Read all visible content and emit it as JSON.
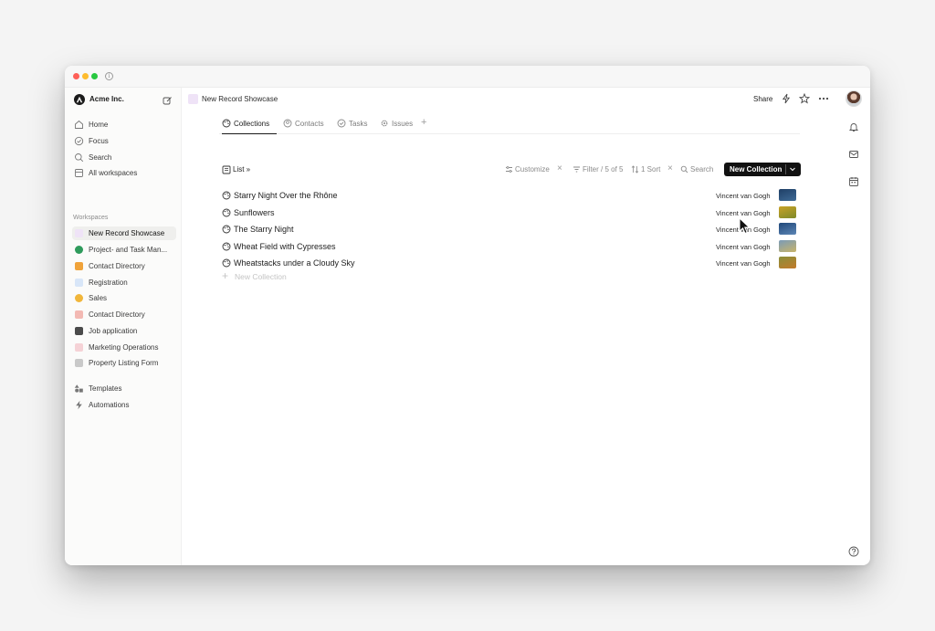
{
  "workspace": {
    "name": "Acme Inc."
  },
  "nav": [
    {
      "label": "Home",
      "icon": "home-icon"
    },
    {
      "label": "Focus",
      "icon": "focus-icon"
    },
    {
      "label": "Search",
      "icon": "search-icon"
    },
    {
      "label": "All workspaces",
      "icon": "workspaces-icon"
    }
  ],
  "workspaces_label": "Workspaces",
  "workspaces": [
    {
      "label": "New Record Showcase",
      "color": "#efe3f7",
      "active": true
    },
    {
      "label": "Project- and Task Man...",
      "color": "#2f9b5c"
    },
    {
      "label": "Contact Directory",
      "color": "#f0a33a"
    },
    {
      "label": "Registration",
      "color": "#d8e6f8"
    },
    {
      "label": "Sales",
      "color": "#f1b63a"
    },
    {
      "label": "Contact Directory",
      "color": "#f3b9b3"
    },
    {
      "label": "Job application",
      "color": "#4b4b4b"
    },
    {
      "label": "Marketing Operations",
      "color": "#f5d2d6"
    },
    {
      "label": "Property Listing Form",
      "color": "#c9c9c9"
    }
  ],
  "footer_nav": [
    {
      "label": "Templates",
      "icon": "templates-icon"
    },
    {
      "label": "Automations",
      "icon": "bolt-icon"
    }
  ],
  "header": {
    "breadcrumb": "New Record Showcase",
    "share": "Share"
  },
  "tabs": [
    {
      "label": "Collections",
      "active": true
    },
    {
      "label": "Contacts"
    },
    {
      "label": "Tasks"
    },
    {
      "label": "Issues"
    }
  ],
  "toolbar": {
    "view": "List »",
    "customize": "Customize",
    "filter": "Filter / 5 of 5",
    "sort": "1 Sort",
    "search": "Search",
    "new_button": "New Collection"
  },
  "rows": [
    {
      "title": "Starry Night Over the Rhône",
      "artist": "Vincent van Gogh",
      "thumb": [
        "#1f3f66",
        "#3f6b97"
      ]
    },
    {
      "title": "Sunflowers",
      "artist": "Vincent van Gogh",
      "thumb": [
        "#c9a227",
        "#7e8a2a"
      ]
    },
    {
      "title": "The Starry Night",
      "artist": "Vincent van Gogh",
      "thumb": [
        "#20487a",
        "#5d86b5"
      ]
    },
    {
      "title": "Wheat Field with Cypresses",
      "artist": "Vincent van Gogh",
      "thumb": [
        "#7a9bb8",
        "#c8b46a"
      ]
    },
    {
      "title": "Wheatstacks under a Cloudy Sky",
      "artist": "Vincent van Gogh",
      "thumb": [
        "#8a8f3a",
        "#c37a2a"
      ]
    }
  ],
  "new_row_label": "New Collection"
}
